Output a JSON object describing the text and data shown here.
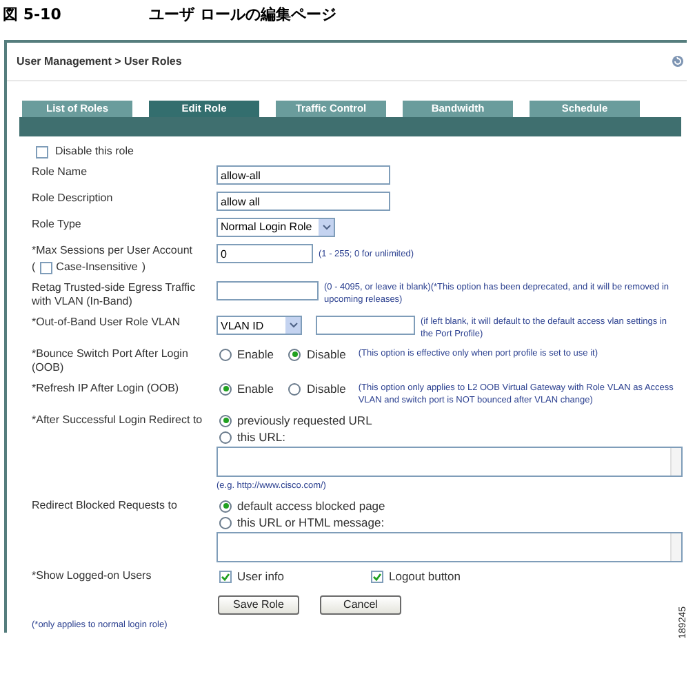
{
  "figure": {
    "number": "図 5-10",
    "title": "ユーザ ロールの編集ページ",
    "id": "189245"
  },
  "breadcrumb": "User Management > User Roles",
  "tabs": [
    {
      "label": "List of Roles",
      "selected": false
    },
    {
      "label": "Edit Role",
      "selected": true
    },
    {
      "label": "Traffic Control",
      "selected": false
    },
    {
      "label": "Bandwidth",
      "selected": false
    },
    {
      "label": "Schedule",
      "selected": false
    }
  ],
  "form": {
    "disable_role": {
      "label": "Disable this role",
      "checked": false
    },
    "rows": [
      {
        "kind": "text",
        "label": "Role Name",
        "value": "allow-all"
      },
      {
        "kind": "text",
        "label": "Role Description",
        "value": "allow all"
      },
      {
        "kind": "select",
        "label": "Role Type",
        "value": "Normal Login Role"
      },
      {
        "kind": "sessions",
        "label": "*Max Sessions per User Account",
        "open": "(",
        "checkbox": {
          "label": "Case-Insensitive",
          "checked": false
        },
        "close": ")",
        "value": "0",
        "hint": "(1 - 255; 0 for unlimited)"
      },
      {
        "kind": "text",
        "label": "Retag Trusted-side Egress Traffic with VLAN (In-Band)",
        "value": "",
        "hint": "(0 - 4095, or leave it blank)(*This option has been deprecated, and it will be removed in upcoming releases)"
      },
      {
        "kind": "vlan",
        "label": "*Out-of-Band User Role VLAN",
        "select": "VLAN ID",
        "value": "",
        "hint": "(if left blank, it will default to the default access vlan settings in the Port Profile)"
      },
      {
        "kind": "radio",
        "label": "*Bounce Switch Port After Login (OOB)",
        "options": [
          {
            "label": "Enable",
            "selected": false
          },
          {
            "label": "Disable",
            "selected": true
          }
        ],
        "hint": "(This option is effective only when port profile is set to use it)"
      },
      {
        "kind": "radio",
        "label": "*Refresh IP After Login (OOB)",
        "options": [
          {
            "label": "Enable",
            "selected": true
          },
          {
            "label": "Disable",
            "selected": false
          }
        ],
        "hint": "(This option only applies to L2 OOB Virtual Gateway with Role VLAN as Access VLAN and switch port is NOT bounced after VLAN change)"
      },
      {
        "kind": "redirect",
        "label": "*After Successful Login Redirect to",
        "options": [
          {
            "label": "previously requested URL",
            "selected": true
          },
          {
            "label": "this URL:",
            "selected": false
          }
        ],
        "hint": "(e.g. http://www.cisco.com/)"
      },
      {
        "kind": "redirect",
        "label": "Redirect Blocked Requests to",
        "options": [
          {
            "label": "default access blocked page",
            "selected": true
          },
          {
            "label": "this URL or HTML message:",
            "selected": false
          }
        ]
      },
      {
        "kind": "checks",
        "label": "*Show Logged-on Users",
        "options": [
          {
            "label": "User info",
            "checked": true
          },
          {
            "label": "Logout button",
            "checked": true
          }
        ]
      }
    ],
    "buttons": [
      "Save Role",
      "Cancel"
    ],
    "footnote": "(*only applies to normal login role)"
  }
}
